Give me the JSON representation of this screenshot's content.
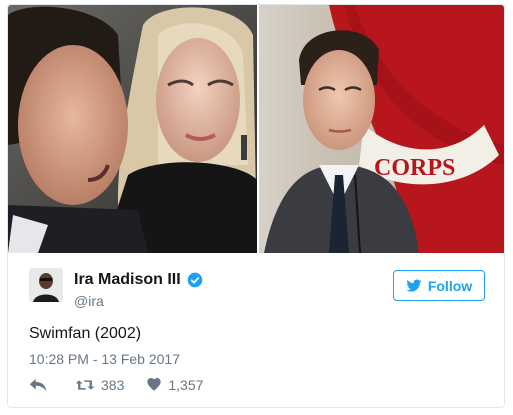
{
  "tweet": {
    "author": {
      "name": "Ira Madison III",
      "handle": "@ira",
      "verified": true
    },
    "follow_label": "Follow",
    "text": "Swimfan (2002)",
    "timestamp": "10:28 PM - 13 Feb 2017",
    "retweets": "383",
    "likes": "1,357"
  },
  "colors": {
    "accent": "#1da1f2",
    "muted": "#657786",
    "text": "#14171a"
  },
  "icons": {
    "reply": "reply-icon",
    "retweet": "retweet-icon",
    "like": "heart-icon",
    "follow": "twitter-bird-icon",
    "verified": "verified-badge-icon"
  }
}
